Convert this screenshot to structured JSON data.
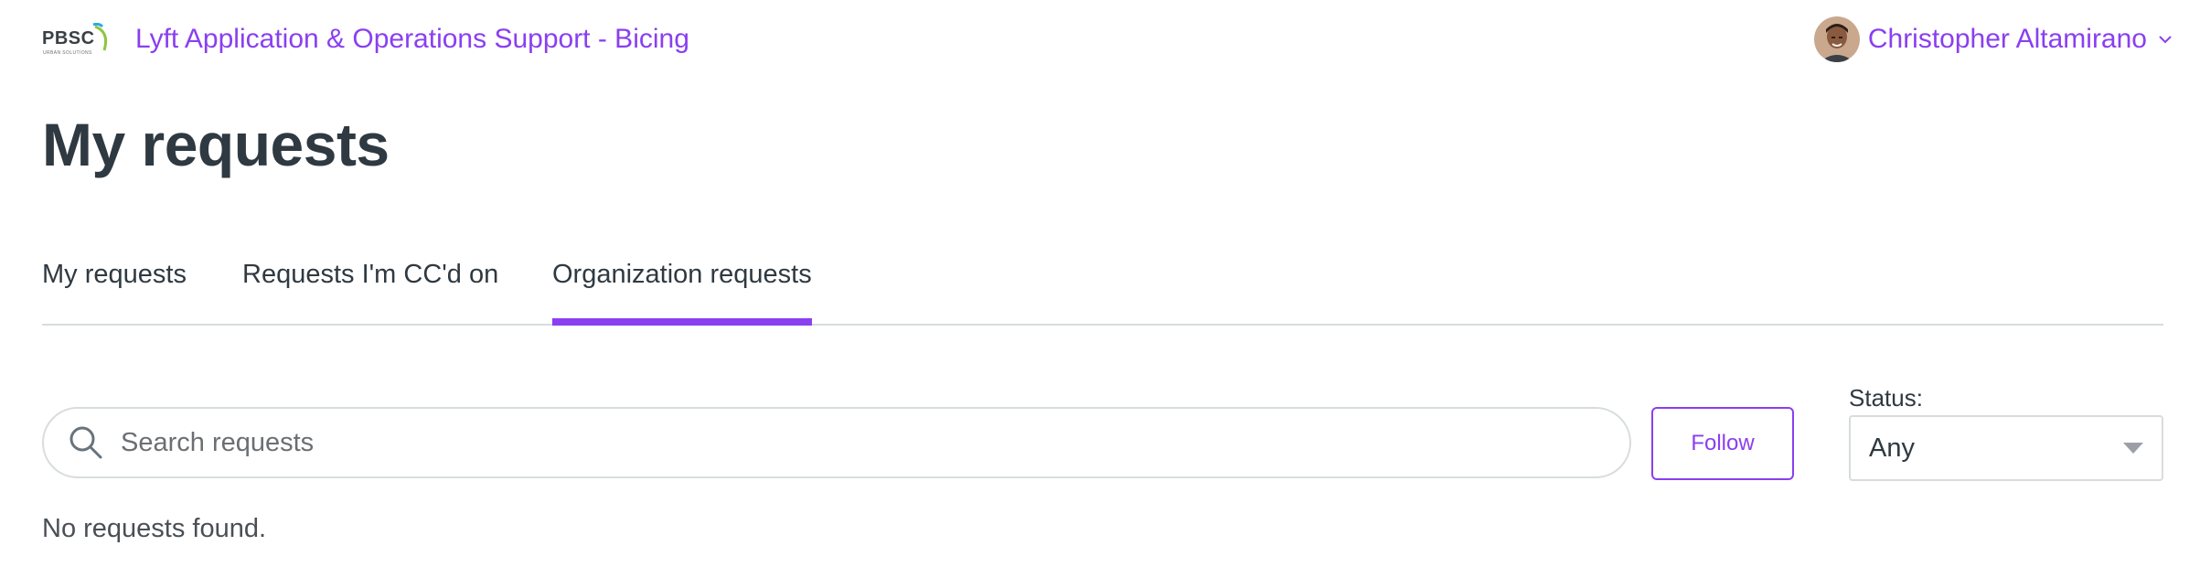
{
  "header": {
    "logo_text": "PBSC",
    "logo_subtext": "URBAN SOLUTIONS",
    "brand_title": "Lyft Application & Operations Support - Bicing",
    "user_name": "Christopher Altamirano"
  },
  "page_title": "My requests",
  "tabs": [
    {
      "label": "My requests",
      "active": false
    },
    {
      "label": "Requests I'm CC'd on",
      "active": false
    },
    {
      "label": "Organization requests",
      "active": true
    }
  ],
  "search": {
    "placeholder": "Search requests",
    "value": ""
  },
  "follow_button": "Follow",
  "status_filter": {
    "label": "Status:",
    "selected": "Any"
  },
  "empty_message": "No requests found.",
  "colors": {
    "accent": "#8a3ff0",
    "text": "#2f3941",
    "border": "#d8dcde"
  },
  "icons": [
    "pbsc-logo",
    "avatar",
    "chevron-down-icon",
    "search-icon",
    "caret-down-icon"
  ]
}
